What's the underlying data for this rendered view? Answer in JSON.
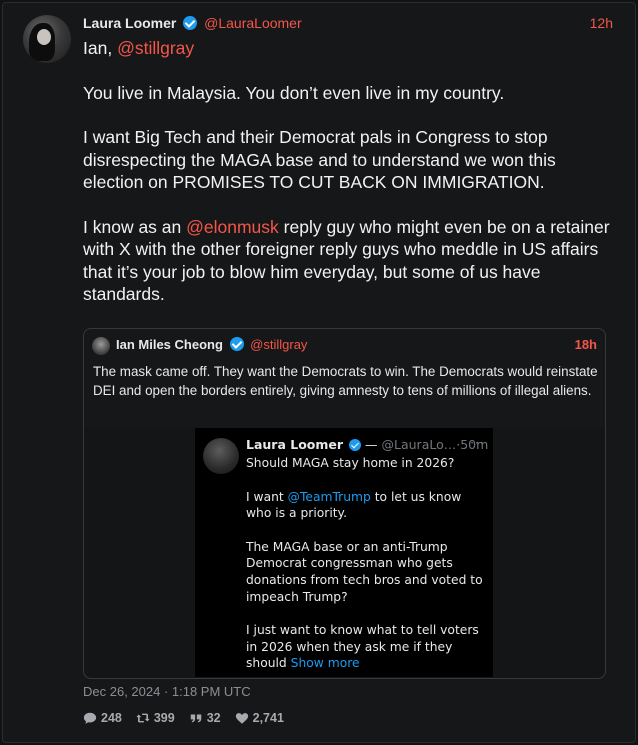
{
  "tweet": {
    "author_name": "Laura Loomer",
    "author_handle": "@LauraLoomer",
    "time": "12h",
    "greeting": "Ian, ",
    "greeting_mention": "@stillgray",
    "para1": "You live in Malaysia. You don’t even live in my country.",
    "para2": "I want Big Tech and their Democrat pals in Congress to stop disrespecting the MAGA base and to understand we won this election on PROMISES TO CUT BACK ON IMMIGRATION.",
    "para3_before": "I know as an ",
    "para3_mention": "@elonmusk",
    "para3_after": " reply guy who might even be on a retainer with X with the other foreigner reply guys who meddle in US affairs that it’s your job to blow him everyday, but some of us have standards.",
    "date": "Dec 26, 2024 · 1:18 PM UTC",
    "stats": {
      "replies": "248",
      "reposts": "399",
      "quotes": "32",
      "likes": "2,741"
    }
  },
  "quoted": {
    "author_name": "Ian Miles Cheong",
    "author_handle": "@stillgray",
    "time": "18h",
    "text": "The mask came off. They want the Democrats to win. The Democrats would reinstate DEI and open the borders entirely, giving amnesty to tens of millions of illegal aliens.",
    "screenshot": {
      "author_name": "Laura Loomer",
      "dash": "—",
      "handle_time": "@LauraLo…·50m",
      "more": "···",
      "line1": "Should MAGA stay home in 2026?",
      "line2_before": "I want ",
      "line2_link": "@TeamTrump",
      "line2_after": " to let us know who is a priority.",
      "line3": "The MAGA base or an anti-Trump Democrat congressman who gets donations from tech bros and voted to impeach Trump?",
      "line4": "I just want to know what to tell voters in 2026 when they ask me if they should ",
      "show_more": "Show more"
    }
  },
  "colors": {
    "accent": "#f4564a",
    "verified": "#1d9bf0",
    "background": "#161718"
  },
  "icons": [
    "verified-badge-icon",
    "reply-icon",
    "repost-icon",
    "quote-icon",
    "like-icon",
    "more-icon"
  ]
}
